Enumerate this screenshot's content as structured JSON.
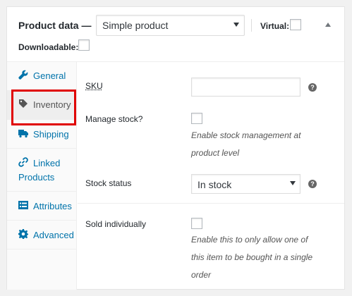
{
  "header": {
    "title": "Product data —",
    "product_type": "Simple product",
    "virtual_label": "Virtual:",
    "downloadable_label": "Downloadable:"
  },
  "tabs": [
    {
      "label": "General",
      "icon": "wrench-icon"
    },
    {
      "label": "Inventory",
      "icon": "tag-icon",
      "active": true
    },
    {
      "label": "Shipping",
      "icon": "truck-icon"
    },
    {
      "label": "Linked",
      "label2": "Products",
      "icon": "link-icon"
    },
    {
      "label": "Attributes",
      "icon": "list-icon"
    },
    {
      "label": "Advanced",
      "icon": "gear-icon"
    }
  ],
  "fields": {
    "sku_label": "SKU",
    "sku_value": "",
    "manage_stock_label": "Manage stock?",
    "manage_stock_desc_1": "Enable stock management at",
    "manage_stock_desc_2": "product level",
    "stock_status_label": "Stock status",
    "stock_status_value": "In stock",
    "sold_individually_label": "Sold individually",
    "sold_desc_1": "Enable this to only allow one of",
    "sold_desc_2": "this item to be bought in a single",
    "sold_desc_3": "order",
    "help_glyph": "?"
  },
  "colors": {
    "link": "#0073aa",
    "highlight": "#e00000"
  }
}
